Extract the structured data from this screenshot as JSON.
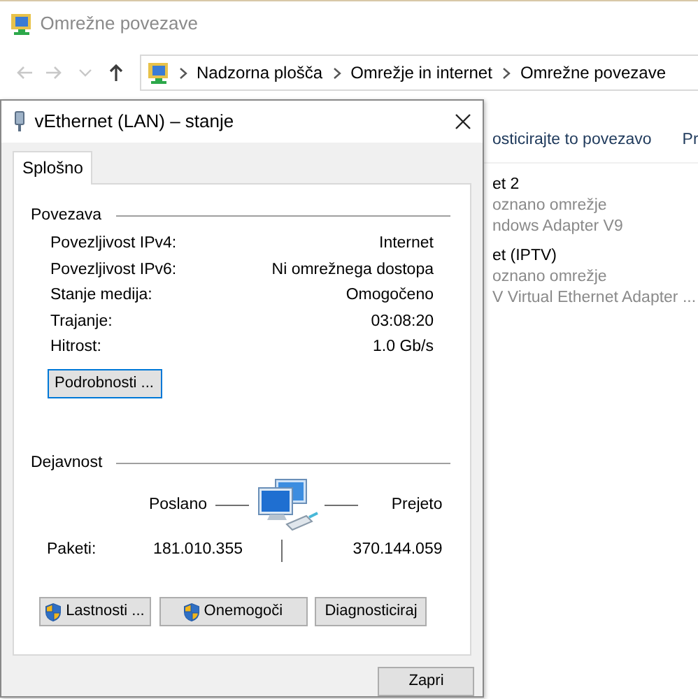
{
  "explorer": {
    "title": "Omrežne povezave",
    "nav": [
      {
        "kind": "back",
        "disabled": true
      },
      {
        "kind": "forward",
        "disabled": true
      },
      {
        "kind": "recent",
        "disabled": true
      },
      {
        "kind": "up",
        "disabled": false
      }
    ],
    "breadcrumb": [
      "Nadzorna plošča",
      "Omrežje in internet",
      "Omrežne povezave"
    ],
    "toolbar": [
      "osticirajte to povezavo",
      "Pr"
    ],
    "connections": [
      {
        "name": "et 2",
        "status": "oznano omrežje",
        "adapter": "ndows Adapter V9"
      },
      {
        "name": "et (IPTV)",
        "status": "oznano omrežje",
        "adapter": "V Virtual Ethernet Adapter ..."
      }
    ]
  },
  "dialog": {
    "title": "vEthernet (LAN) – stanje",
    "tabs": [
      {
        "label": "Splošno",
        "selected": true
      }
    ],
    "connection": {
      "heading": "Povezava",
      "rows": [
        {
          "label": "Povezljivost IPv4:",
          "value": "Internet"
        },
        {
          "label": "Povezljivost IPv6:",
          "value": "Ni omrežnega dostopa"
        },
        {
          "label": "Stanje medija:",
          "value": "Omogočeno"
        },
        {
          "label": "Trajanje:",
          "value": "03:08:20"
        },
        {
          "label": "Hitrost:",
          "value": "1.0 Gb/s"
        }
      ],
      "details_button": "Podrobnosti ..."
    },
    "activity": {
      "heading": "Dejavnost",
      "sent_label": "Poslano",
      "received_label": "Prejeto",
      "packets_label": "Paketi:",
      "sent": "181.010.355",
      "received": "370.144.059"
    },
    "buttons": [
      {
        "label": "Lastnosti ...",
        "shield": true
      },
      {
        "label": "Onemogoči",
        "shield": true
      },
      {
        "label": "Diagnosticiraj",
        "shield": false
      }
    ],
    "close_button": "Zapri"
  }
}
